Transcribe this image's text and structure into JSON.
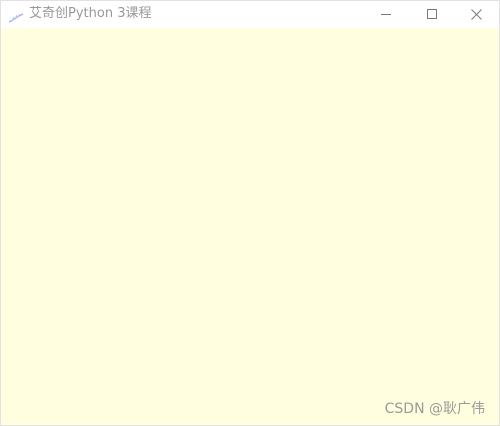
{
  "window": {
    "title": "艾奇创Python 3课程",
    "app_icon": "feather-icon",
    "controls": {
      "minimize_icon": "minimize-icon",
      "maximize_icon": "maximize-icon",
      "close_icon": "close-icon"
    }
  },
  "client": {
    "background_color": "#ffffe0"
  },
  "watermark": {
    "text": "CSDN @耿广伟"
  }
}
